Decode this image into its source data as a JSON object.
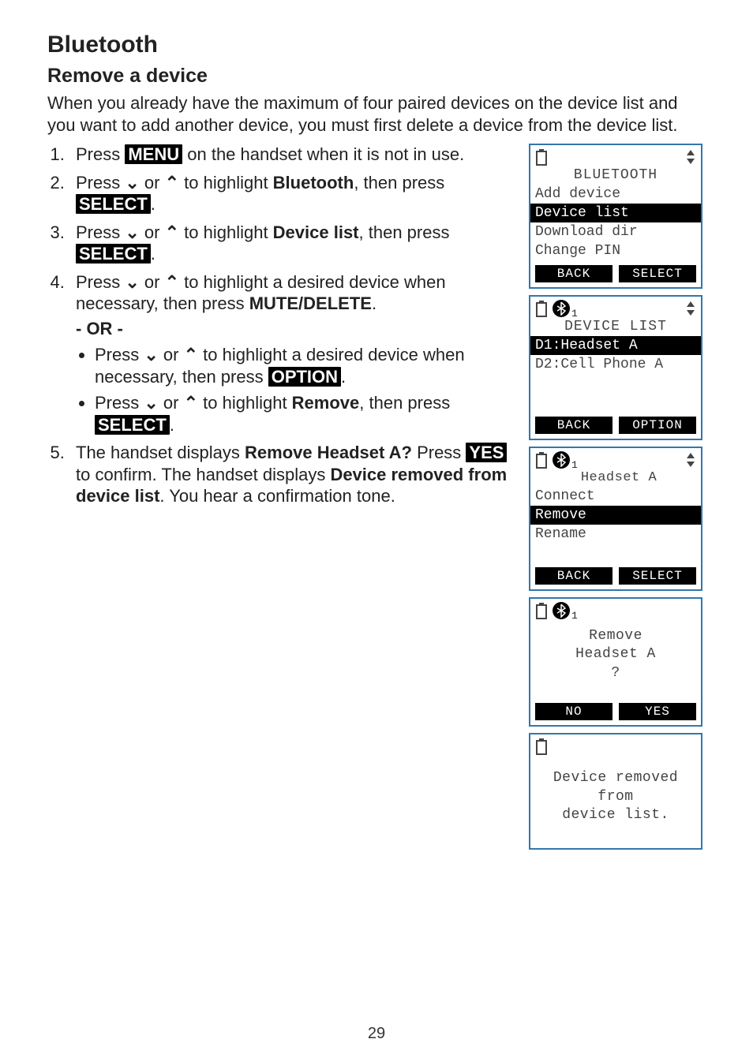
{
  "heading": "Bluetooth",
  "subheading": "Remove a device",
  "intro": "When you already have the maximum of four paired devices on the device list and you want to add another device, you must first delete a device from the device list.",
  "buttons": {
    "menu": "MENU",
    "select": "SELECT",
    "option": "OPTION",
    "yes": "YES",
    "mute_delete_pre": "MUTE",
    "mute_delete_post": "/DELETE"
  },
  "steps": {
    "s1_pre": "Press ",
    "s1_post": " on the handset when it is not in use.",
    "s2_pre": "Press ",
    "chev_down": "⌄",
    "or_word": " or ",
    "chev_up": "⌃",
    "s2_mid": " to highlight ",
    "s2_hl": "Bluetooth",
    "s2_then": ", then press ",
    "s3_mid": " to highlight ",
    "s3_hl": "Device list",
    "s3_then": ", then press ",
    "s4_mid": " to highlight a desired device when necessary, then press ",
    "or_label": "- OR -",
    "sub1_mid": " to highlight a desired device when necessary, then press ",
    "sub2_mid": " to highlight ",
    "sub2_hl": "Remove",
    "sub2_then": ", then press ",
    "s5_pre": "The handset displays ",
    "s5_q": "Remove Headset A?",
    "s5_mid": " Press ",
    "s5_mid2": " to confirm. The handset displays ",
    "s5_msg": "Device removed from device list",
    "s5_end": ". You hear a confirmation tone."
  },
  "screens": {
    "s1": {
      "title": "BLUETOOTH",
      "items": [
        "Add device",
        "Device list",
        "Download dir",
        "Change PIN"
      ],
      "sel": 1,
      "soft": [
        "BACK",
        "SELECT"
      ]
    },
    "s2": {
      "bt_idx": "1",
      "title": "DEVICE LIST",
      "items": [
        "D1:Headset A",
        "D2:Cell Phone A"
      ],
      "sel": 0,
      "soft": [
        "BACK",
        "OPTION"
      ]
    },
    "s3": {
      "bt_idx": "1",
      "title": "Headset A",
      "items": [
        "Connect",
        "Remove",
        "Rename"
      ],
      "sel": 1,
      "soft": [
        "BACK",
        "SELECT"
      ]
    },
    "s4": {
      "bt_idx": "1",
      "msg1": "Remove",
      "msg2": "Headset A",
      "msg3": "?",
      "soft": [
        "NO",
        "YES"
      ]
    },
    "s5": {
      "msg1": "Device removed",
      "msg2": "from",
      "msg3": "device list."
    }
  },
  "page_number": "29"
}
